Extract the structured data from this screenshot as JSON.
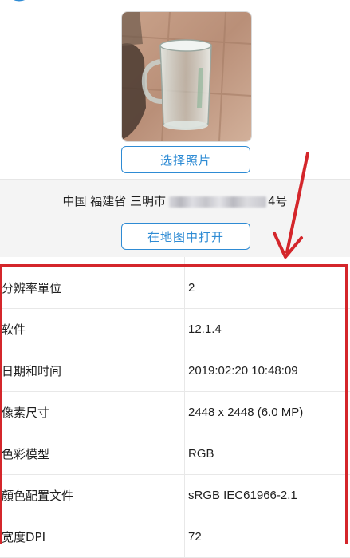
{
  "photo": {
    "choose_label": "选择照片"
  },
  "location": {
    "address_prefix": "中国 福建省 三明市",
    "address_suffix": "4号",
    "open_map_label": "在地图中打开"
  },
  "metadata": {
    "rows": [
      {
        "key": "分辨率單位",
        "value": "2"
      },
      {
        "key": "软件",
        "value": "12.1.4"
      },
      {
        "key": "日期和时间",
        "value": "2019:02:20 10:48:09"
      },
      {
        "key": "像素尺寸",
        "value": "2448 x 2448 (6.0 MP)"
      },
      {
        "key": "色彩模型",
        "value": "RGB"
      },
      {
        "key": "顏色配置文件",
        "value": "sRGB IEC61966-2.1"
      },
      {
        "key": "宽度DPI",
        "value": "72"
      }
    ]
  },
  "colors": {
    "accent": "#2e8bd4",
    "annotation_red": "#d4262b",
    "location_bg": "#f4f4f4"
  },
  "icons": {
    "top_logo": "app-logo-icon",
    "thumbnail": "glass-mug-photo",
    "annotation": "red-arrow-annotation"
  }
}
